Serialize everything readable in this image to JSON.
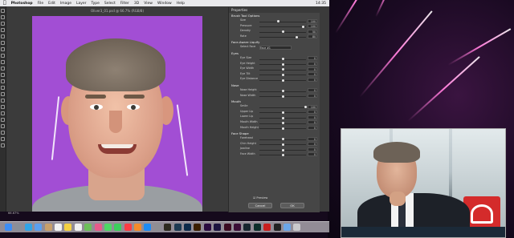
{
  "menubar": {
    "apple_icon": "apple-icon",
    "items": [
      "Photoshop",
      "File",
      "Edit",
      "Image",
      "Layer",
      "Type",
      "Select",
      "Filter",
      "3D",
      "View",
      "Window",
      "Help"
    ],
    "status": [
      "14:35"
    ]
  },
  "document": {
    "title": "Oliver3_01.psd @ 66.7% (RGB/8)"
  },
  "statusbar": {
    "zoom": "66.67%"
  },
  "properties": {
    "title": "Properties",
    "sections": [
      {
        "heading": "Brush Tool Options",
        "rows": [
          {
            "label": "Size",
            "value": "100",
            "knob": 0.4
          },
          {
            "label": "Pressure",
            "value": "100",
            "knob": 0.95
          },
          {
            "label": "Density",
            "value": "50",
            "knob": 0.5
          },
          {
            "label": "Rate",
            "value": "80",
            "knob": 0.8
          }
        ]
      },
      {
        "heading": "Face-Aware Liquify",
        "rows": [
          {
            "label": "Select Face",
            "value": "Face #1",
            "knob": null
          }
        ]
      },
      {
        "heading": "Eyes",
        "rows": [
          {
            "label": "Eye Size",
            "value": "0",
            "knob": 0.5
          },
          {
            "label": "Eye Height",
            "value": "0",
            "knob": 0.5
          },
          {
            "label": "Eye Width",
            "value": "0",
            "knob": 0.5
          },
          {
            "label": "Eye Tilt",
            "value": "0",
            "knob": 0.5
          },
          {
            "label": "Eye Distance",
            "value": "0",
            "knob": 0.5
          }
        ]
      },
      {
        "heading": "Nose",
        "rows": [
          {
            "label": "Nose Height",
            "value": "0",
            "knob": 0.5
          },
          {
            "label": "Nose Width",
            "value": "0",
            "knob": 0.5
          }
        ]
      },
      {
        "heading": "Mouth",
        "rows": [
          {
            "label": "Smile",
            "value": "100",
            "knob": 1.0
          },
          {
            "label": "Upper Lip",
            "value": "0",
            "knob": 0.5
          },
          {
            "label": "Lower Lip",
            "value": "0",
            "knob": 0.5
          },
          {
            "label": "Mouth Width",
            "value": "0",
            "knob": 0.5
          },
          {
            "label": "Mouth Height",
            "value": "0",
            "knob": 0.5
          }
        ]
      },
      {
        "heading": "Face Shape",
        "rows": [
          {
            "label": "Forehead",
            "value": "0",
            "knob": 0.5
          },
          {
            "label": "Chin Height",
            "value": "0",
            "knob": 0.5
          },
          {
            "label": "Jawline",
            "value": "0",
            "knob": 0.5
          },
          {
            "label": "Face Width",
            "value": "0",
            "knob": 0.5
          }
        ]
      }
    ],
    "preview_label": "Preview",
    "cancel_label": "Cancel",
    "ok_label": "OK"
  },
  "dock": {
    "icons": [
      {
        "name": "finder-icon",
        "color": "#3d8df5"
      },
      {
        "name": "launchpad-icon",
        "color": "#8a8f99"
      },
      {
        "name": "safari-icon",
        "color": "#2fa4e7"
      },
      {
        "name": "mail-icon",
        "color": "#5aa0f0"
      },
      {
        "name": "contacts-icon",
        "color": "#c8a06a"
      },
      {
        "name": "calendar-icon",
        "color": "#f2f2f2"
      },
      {
        "name": "notes-icon",
        "color": "#f5d142"
      },
      {
        "name": "reminders-icon",
        "color": "#f0f0f0"
      },
      {
        "name": "maps-icon",
        "color": "#6dbf5a"
      },
      {
        "name": "photos-icon",
        "color": "#e85a8a"
      },
      {
        "name": "messages-icon",
        "color": "#4cd964"
      },
      {
        "name": "facetime-icon",
        "color": "#3ccf5c"
      },
      {
        "name": "music-icon",
        "color": "#fc3c44"
      },
      {
        "name": "books-icon",
        "color": "#f48b2a"
      },
      {
        "name": "appstore-icon",
        "color": "#1c8cf5"
      },
      {
        "name": "settings-icon",
        "color": "#8e8e93"
      },
      {
        "name": "bridge-icon",
        "color": "#2d2a1f"
      },
      {
        "name": "lightroom-icon",
        "color": "#1d3a52"
      },
      {
        "name": "photoshop-icon",
        "color": "#0d2a4a"
      },
      {
        "name": "illustrator-icon",
        "color": "#3a1e00"
      },
      {
        "name": "premiere-icon",
        "color": "#2a0b3f"
      },
      {
        "name": "aftereffects-icon",
        "color": "#1c1440"
      },
      {
        "name": "indesign-icon",
        "color": "#3b0b22"
      },
      {
        "name": "xd-icon",
        "color": "#3a0d36"
      },
      {
        "name": "dimension-icon",
        "color": "#16262e"
      },
      {
        "name": "audition-icon",
        "color": "#0b2e2a"
      },
      {
        "name": "acrobat-icon",
        "color": "#c81e1e"
      },
      {
        "name": "terminal-icon",
        "color": "#222222"
      },
      {
        "name": "downloads-icon",
        "color": "#6ba6e8"
      },
      {
        "name": "trash-icon",
        "color": "#c9c9cc"
      }
    ]
  },
  "colors": {
    "canvas_background": "#a24ed4",
    "ps_workspace": "#3b3b3b",
    "panel": "#464646",
    "stage_accent": "#ff7ad9"
  }
}
